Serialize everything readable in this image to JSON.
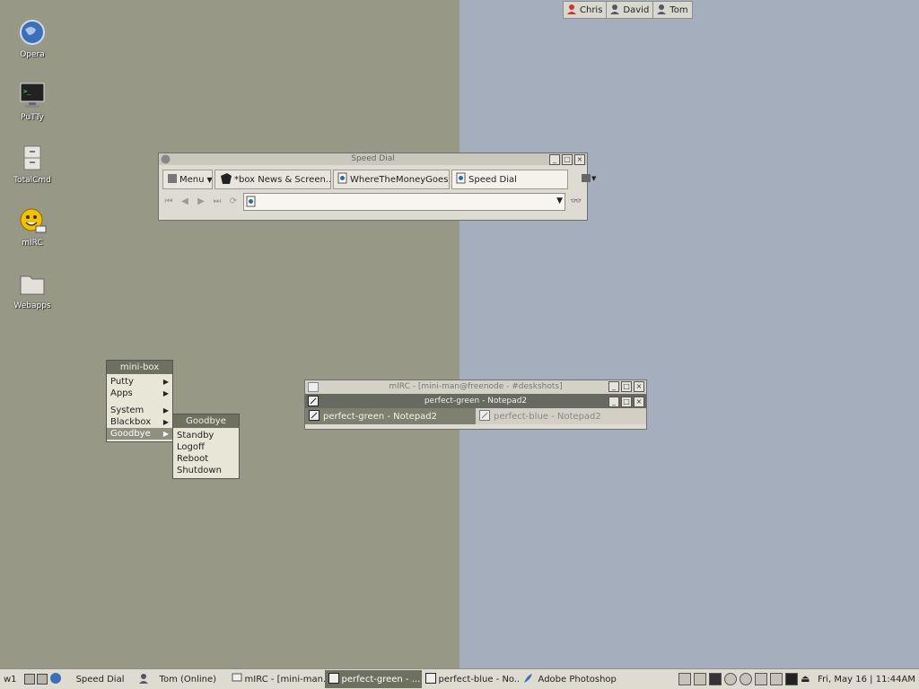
{
  "desktop": {
    "icons": [
      {
        "label": "Opera",
        "icon": "globe-icon"
      },
      {
        "label": "PuTTy",
        "icon": "terminal-icon"
      },
      {
        "label": "TotalCmd",
        "icon": "cabinet-icon"
      },
      {
        "label": "mIRC",
        "icon": "smiley-icon"
      },
      {
        "label": "Webapps",
        "icon": "folder-icon"
      }
    ]
  },
  "contacts": [
    "Chris",
    "David",
    "Tom"
  ],
  "speed_dial": {
    "title": "Speed Dial",
    "tabs": [
      {
        "label": "Menu"
      },
      {
        "label": "*box News & Screen..."
      },
      {
        "label": "WhereTheMoneyGoes..."
      },
      {
        "label": "Speed Dial"
      }
    ]
  },
  "minibox": {
    "title": "mini-box",
    "items": [
      "Putty",
      "Apps",
      "System",
      "Blackbox",
      "Goodbye"
    ]
  },
  "goodbye": {
    "title": "Goodbye",
    "items": [
      "Standby",
      "Logoff",
      "Reboot",
      "Shutdown"
    ]
  },
  "mirc": {
    "title": "mIRC - [mini-man@freenode - #deskshots]"
  },
  "notepad": {
    "title": "perfect-green - Notepad2",
    "tabs": [
      "perfect-green - Notepad2",
      "perfect-blue - Notepad2"
    ]
  },
  "taskbar": {
    "workspace": "w1",
    "items": [
      "Speed Dial",
      "Tom (Online)",
      "mIRC - [mini-man...",
      "perfect-green - ...",
      "perfect-blue - No...",
      "Adobe Photoshop"
    ],
    "clock": "Fri, May 16 | 11:44AM"
  }
}
